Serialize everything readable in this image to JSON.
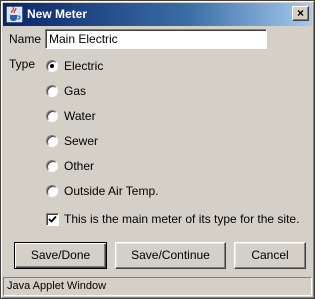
{
  "window": {
    "title": "New Meter",
    "close_label": "×"
  },
  "form": {
    "name_label": "Name",
    "name_value": "Main Electric",
    "type_label": "Type",
    "type_options": [
      {
        "label": "Electric",
        "checked": true
      },
      {
        "label": "Gas",
        "checked": false
      },
      {
        "label": "Water",
        "checked": false
      },
      {
        "label": "Sewer",
        "checked": false
      },
      {
        "label": "Other",
        "checked": false
      },
      {
        "label": "Outside Air Temp.",
        "checked": false
      }
    ],
    "main_meter_label": "This is the main meter of its type for the site.",
    "main_meter_checked": true
  },
  "buttons": {
    "save_done": "Save/Done",
    "save_continue": "Save/Continue",
    "cancel": "Cancel"
  },
  "status": {
    "text": "Java Applet Window"
  },
  "colors": {
    "titlebar_start": "#0a246a",
    "titlebar_end": "#a6caf0",
    "face": "#d4d0c8"
  }
}
